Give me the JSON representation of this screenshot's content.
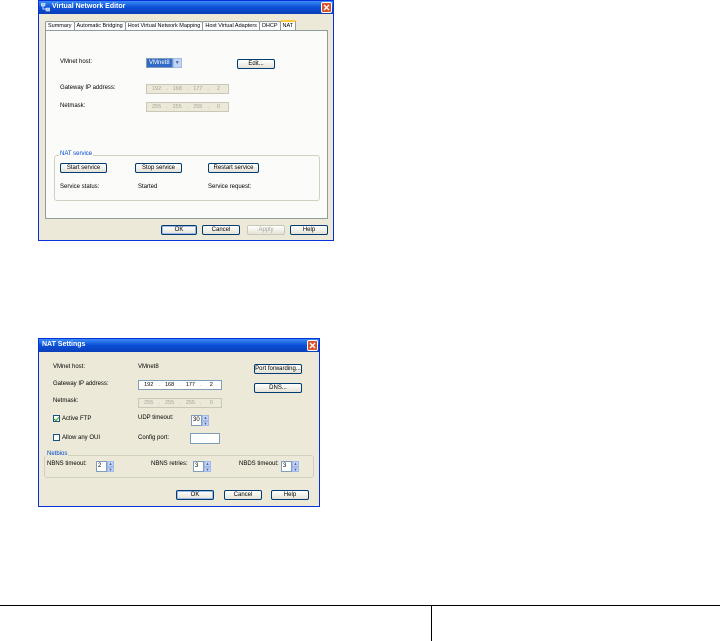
{
  "dialog1": {
    "title": "Virtual Network Editor",
    "tabs": [
      "Summary",
      "Automatic Bridging",
      "Host Virtual Network Mapping",
      "Host Virtual Adapters",
      "DHCP",
      "NAT"
    ],
    "vmnet_host_label": "VMnet host:",
    "vmnet_host_value": "VMnet8",
    "edit_button": "Edit...",
    "gateway_label": "Gateway IP address:",
    "gateway_ip": [
      "192",
      "168",
      "177",
      "2"
    ],
    "netmask_label": "Netmask:",
    "netmask": [
      "255",
      "255",
      "255",
      "0"
    ],
    "nat_service": {
      "title": "NAT service",
      "start": "Start service",
      "stop": "Stop service",
      "restart": "Restart service",
      "status_label": "Service status:",
      "status_value": "Started",
      "request_label": "Service request:"
    },
    "buttons": {
      "ok": "OK",
      "cancel": "Cancel",
      "apply": "Apply",
      "help": "Help"
    }
  },
  "dialog2": {
    "title": "NAT Settings",
    "vmnet_host_label": "VMnet host:",
    "vmnet_host_value": "VMnet8",
    "port_forwarding_button": "Port forwarding...",
    "gateway_label": "Gateway IP address:",
    "gateway_ip": [
      "192",
      "168",
      "177",
      "2"
    ],
    "dns_button": "DNS...",
    "netmask_label": "Netmask:",
    "netmask": [
      "255",
      "255",
      "255",
      "0"
    ],
    "active_ftp_label": "Active FTP",
    "active_ftp_checked": true,
    "udp_timeout_label": "UDP timeout:",
    "udp_timeout_value": "30",
    "allow_oui_label": "Allow any OUI",
    "allow_oui_checked": false,
    "config_port_label": "Config port:",
    "config_port_value": "",
    "netbios": {
      "title": "Netbios",
      "nbns_timeout_label": "NBNS timeout:",
      "nbns_timeout_value": "2",
      "nbns_retries_label": "NBNS retries:",
      "nbns_retries_value": "3",
      "nbds_timeout_label": "NBDS timeout:",
      "nbds_timeout_value": "3"
    },
    "buttons": {
      "ok": "OK",
      "cancel": "Cancel",
      "help": "Help"
    }
  },
  "colors": {
    "title_blue": "#0a4ed6",
    "dialog_bg": "#ece9d8",
    "close_red": "#d9542c",
    "group_title": "#0046d5"
  }
}
